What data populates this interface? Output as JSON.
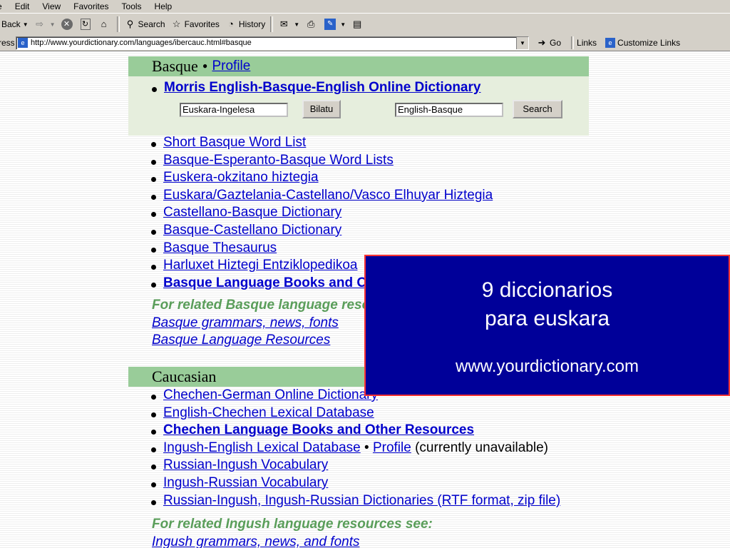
{
  "menu": [
    "e",
    "Edit",
    "View",
    "Favorites",
    "Tools",
    "Help"
  ],
  "toolbar": {
    "back": "Back",
    "search": "Search",
    "favorites": "Favorites",
    "history": "History"
  },
  "address": {
    "label": "ress",
    "url": "http://www.yourdictionary.com/languages/ibercauc.html#basque",
    "go": "Go",
    "links": "Links",
    "customize": "Customize Links"
  },
  "basque": {
    "heading": "Basque",
    "profile": "Profile",
    "morris": "Morris English-Basque-English Online Dictionary",
    "input1": "Euskara-Ingelesa",
    "button1": "Bilatu",
    "input2": "English-Basque",
    "button2": "Search",
    "items": [
      "Short Basque Word List",
      "Basque-Esperanto-Basque Word Lists",
      "Euskera-okzitano hiztegia",
      "Euskara/Gaztelania-Castellano/Vasco Elhuyar Hiztegia",
      "Castellano-Basque Dictionary",
      "Basque-Castellano Dictionary",
      "Basque Thesaurus",
      "Harluxet Hiztegi Entziklopedikoa",
      "Basque Language Books and Other Resources"
    ],
    "related": "For related Basque language resources see:",
    "related_links": [
      "Basque grammars, news, fonts",
      "Basque Language Resources"
    ]
  },
  "caucasian": {
    "heading": "Caucasian",
    "items": [
      "Chechen-German Online Dictionary",
      "English-Chechen Lexical Database",
      "Chechen Language Books and Other Resources",
      "Ingush-English Lexical Database",
      "Russian-Ingush Vocabulary",
      "Ingush-Russian Vocabulary",
      "Russian-Ingush, Ingush-Russian Dictionaries (RTF format, zip file)"
    ],
    "profile": "Profile",
    "unavailable": "(currently unavailable)",
    "related": "For related Ingush language resources see:",
    "related_link": "Ingush grammars, news, and fonts"
  },
  "overlay": {
    "line1": "9 diccionarios",
    "line2": "para euskara",
    "url": "www.yourdictionary.com"
  },
  "colors": {
    "section_header": "#99cc99",
    "link": "#0000cc",
    "overlay_bg": "#000099",
    "overlay_border": "#ff3333",
    "related_green": "#5a9e5a"
  }
}
